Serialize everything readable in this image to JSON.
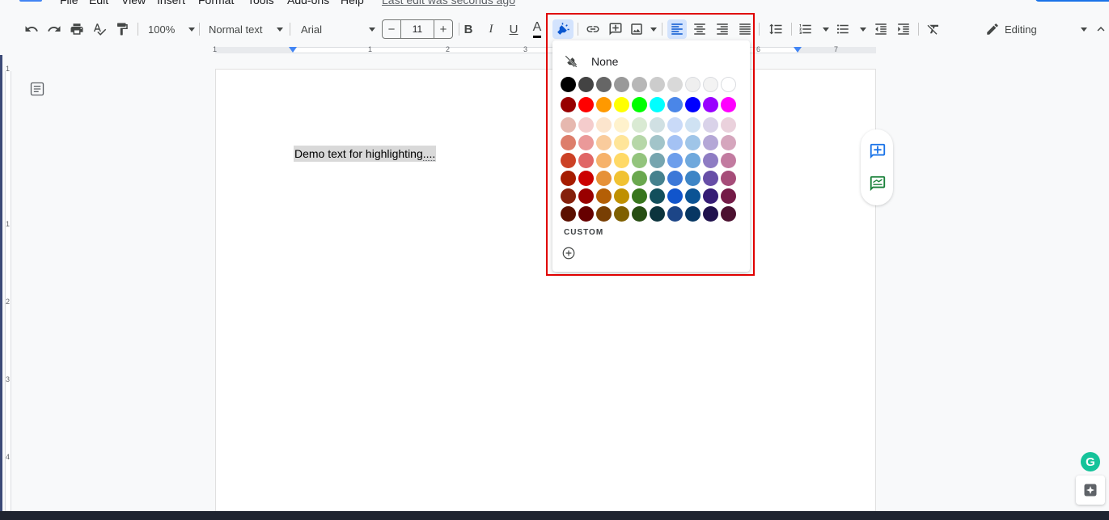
{
  "menubar": {
    "items": [
      "File",
      "Edit",
      "View",
      "Insert",
      "Format",
      "Tools",
      "Add-ons",
      "Help"
    ],
    "last_edit": "Last edit was seconds ago"
  },
  "toolbar": {
    "zoom": "100%",
    "style": "Normal text",
    "font": "Arial",
    "font_size": "11",
    "font_size_minus": "−",
    "font_size_plus": "+",
    "bold": "B",
    "italic": "I",
    "underline": "U",
    "text_color": "A",
    "mode": "Editing"
  },
  "ruler": {
    "numbers": [
      "1",
      "1",
      "2",
      "3",
      "6",
      "7"
    ],
    "vertical_numbers": [
      "1",
      "1",
      "2",
      "3",
      "4"
    ]
  },
  "document": {
    "text": "Demo text for highlighting",
    "trailing": "...."
  },
  "highlight_menu": {
    "none_label": "None",
    "custom_label": "CUSTOM",
    "colors": {
      "row1": [
        "#000000",
        "#434343",
        "#666666",
        "#999999",
        "#b7b7b7",
        "#cccccc",
        "#d9d9d9",
        "#efefef",
        "#f3f3f3",
        "#ffffff"
      ],
      "row2": [
        "#980000",
        "#ff0000",
        "#ff9900",
        "#ffff00",
        "#00ff00",
        "#00ffff",
        "#4a86e8",
        "#0000ff",
        "#9900ff",
        "#ff00ff"
      ],
      "row3": [
        "#e6b8af",
        "#f4cccc",
        "#fce5cd",
        "#fff2cc",
        "#d9ead3",
        "#d0e0e3",
        "#c9daf8",
        "#cfe2f3",
        "#d9d2e9",
        "#ead1dc"
      ],
      "row4": [
        "#dd7e6b",
        "#ea9999",
        "#f9cb9c",
        "#ffe599",
        "#b6d7a8",
        "#a2c4c9",
        "#a4c2f4",
        "#9fc5e8",
        "#b4a7d6",
        "#d5a6bd"
      ],
      "row5": [
        "#cc4125",
        "#e06666",
        "#f6b26b",
        "#ffd966",
        "#93c47d",
        "#76a5af",
        "#6d9eeb",
        "#6fa8dc",
        "#8e7cc3",
        "#c27ba0"
      ],
      "row6": [
        "#a61c00",
        "#cc0000",
        "#e69138",
        "#f1c232",
        "#6aa84f",
        "#45818e",
        "#3c78d8",
        "#3d85c6",
        "#674ea7",
        "#a64d79"
      ],
      "row7": [
        "#85200c",
        "#990000",
        "#b45f06",
        "#bf9000",
        "#38761d",
        "#134f5c",
        "#1155cc",
        "#0b5394",
        "#351c75",
        "#741b47"
      ],
      "row8": [
        "#5b0f00",
        "#660000",
        "#783f04",
        "#7f6000",
        "#274e13",
        "#0c343d",
        "#1c4587",
        "#073763",
        "#20124d",
        "#4c1130"
      ]
    }
  },
  "widgets": {
    "grammarly": "G"
  },
  "accent": {
    "annotation_frame": "#e00000",
    "google_blue": "#1a73e8",
    "add_comment_icon": "#1a73e8",
    "suggest_edit_icon": "#188038"
  }
}
